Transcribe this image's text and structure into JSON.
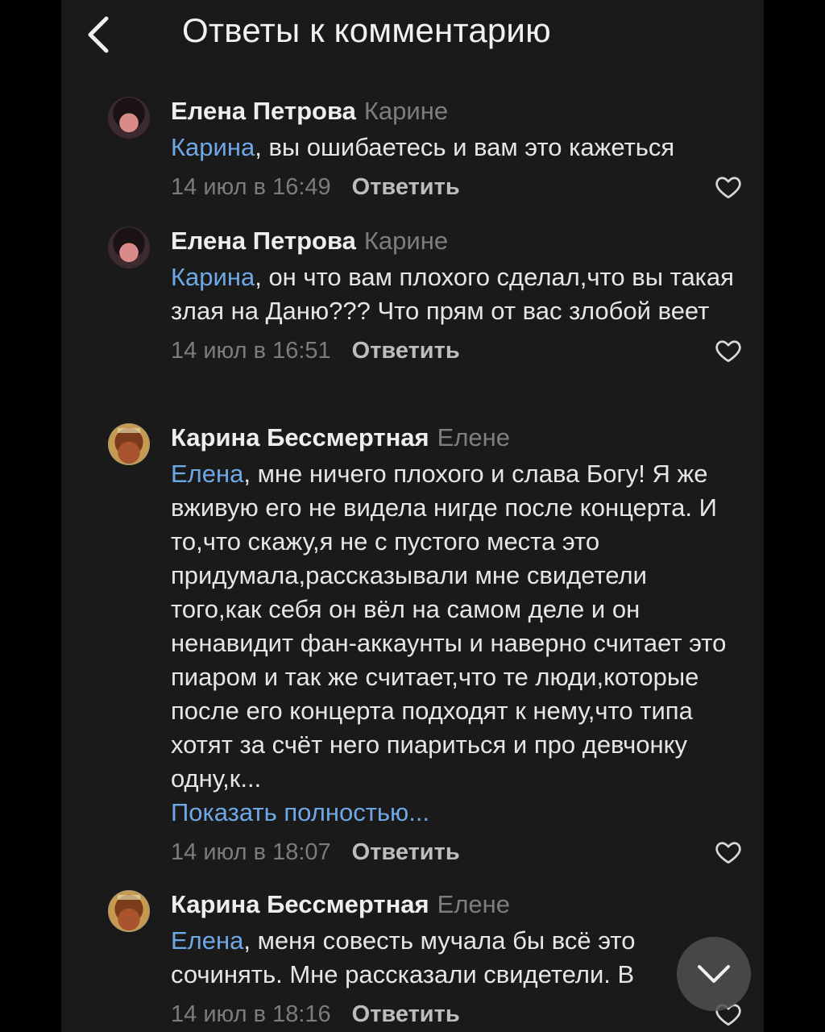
{
  "header": {
    "title": "Ответы к комментарию",
    "back_icon": "chevron-left-icon"
  },
  "comments": [
    {
      "author": "Елена Петрова",
      "reply_to": "Карине",
      "mention": "Карина",
      "text": ", вы ошибаетесь и вам это кажеться",
      "date": "14 июл в 16:49",
      "reply_label": "Ответить",
      "like_icon": "heart-icon"
    },
    {
      "author": "Елена Петрова",
      "reply_to": "Карине",
      "mention": "Карина",
      "text": ", он что вам плохого сделал,что вы такая злая на Даню??? Что прям от вас злобой веет",
      "date": "14 июл в 16:51",
      "reply_label": "Ответить",
      "like_icon": "heart-icon"
    },
    {
      "author": "Карина Бессмертная",
      "reply_to": "Елене",
      "mention": "Елена",
      "text": ", мне ничего плохого и слава Богу! Я же вживую его не видела нигде после концерта. И то,что скажу,я не с пустого места это придумала,рассказывали мне свидетели того,как себя он вёл на самом деле и он ненавидит фан-аккаунты и наверно считает это пиаром и так же считает,что те люди,которые после его концерта подходят к нему,что типа хотят за счёт него пиариться и про девчонку одну,к...",
      "show_more": "Показать полностью...",
      "date": "14 июл в 18:07",
      "reply_label": "Ответить",
      "like_icon": "heart-icon"
    },
    {
      "author": "Карина Бессмертная",
      "reply_to": "Елене",
      "mention": "Елена",
      "text": ", меня совесть мучала бы всё это сочинять. Мне рассказали свидетели. В",
      "date": "14 июл в 18:16",
      "reply_label": "Ответить",
      "like_icon": "heart-icon"
    }
  ],
  "scroll_down_icon": "chevron-down-icon",
  "colors": {
    "background": "#1a1a1a",
    "mention": "#6fa8e6",
    "secondary_text": "#7c7c7c"
  }
}
